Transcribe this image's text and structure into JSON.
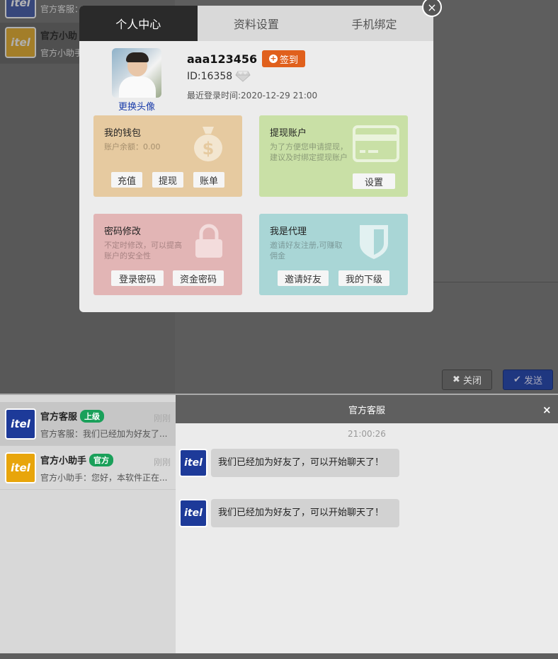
{
  "modal": {
    "tabs": [
      "个人中心",
      "资料设置",
      "手机绑定"
    ],
    "close_icon": "×",
    "change_avatar": "更换头像",
    "username": "aaa123456",
    "signin_label": "签到",
    "user_id": "ID:16358",
    "last_login": "最近登录时间:2020-12-29 21:00",
    "cards": {
      "wallet": {
        "title": "我的钱包",
        "desc": "账户余额：0.00",
        "buttons": [
          "充值",
          "提现",
          "账单"
        ],
        "icon": "$"
      },
      "withdraw": {
        "title": "提现账户",
        "desc": "为了方便您申请提现，建议及时绑定提现账户",
        "button": "设置"
      },
      "password": {
        "title": "密码修改",
        "desc": "不定时修改，可以提高账户的安全性",
        "buttons": [
          "登录密码",
          "资金密码"
        ]
      },
      "agent": {
        "title": "我是代理",
        "desc": "邀请好友注册,可赚取佣金",
        "buttons": [
          "邀请好友",
          "我的下级"
        ]
      }
    }
  },
  "background_top": {
    "contacts": [
      {
        "name": "",
        "preview": "官方客服："
      },
      {
        "name": "官方小助",
        "preview": "官方小助手"
      }
    ],
    "close_button": "关闭",
    "send_button": "发送"
  },
  "contacts": [
    {
      "name": "官方客服",
      "badge": "上级",
      "time": "刚刚",
      "preview": "官方客服：我们已经加为好友了..."
    },
    {
      "name": "官方小助手",
      "badge": "官方",
      "time": "刚刚",
      "preview": "官方小助手：您好，本软件正在..."
    }
  ],
  "chat": {
    "title": "官方客服",
    "close_icon": "×",
    "timestamp": "21:00:26",
    "messages": [
      "我们已经加为好友了，可以开始聊天了！",
      "我们已经加为好友了，可以开始聊天了！"
    ]
  },
  "logo_text": "itel",
  "colors": {
    "accent_blue": "#1d3a99",
    "accent_orange": "#e0601c",
    "badge_green": "#1aa05a",
    "logo_yellow": "#e8a50b"
  }
}
